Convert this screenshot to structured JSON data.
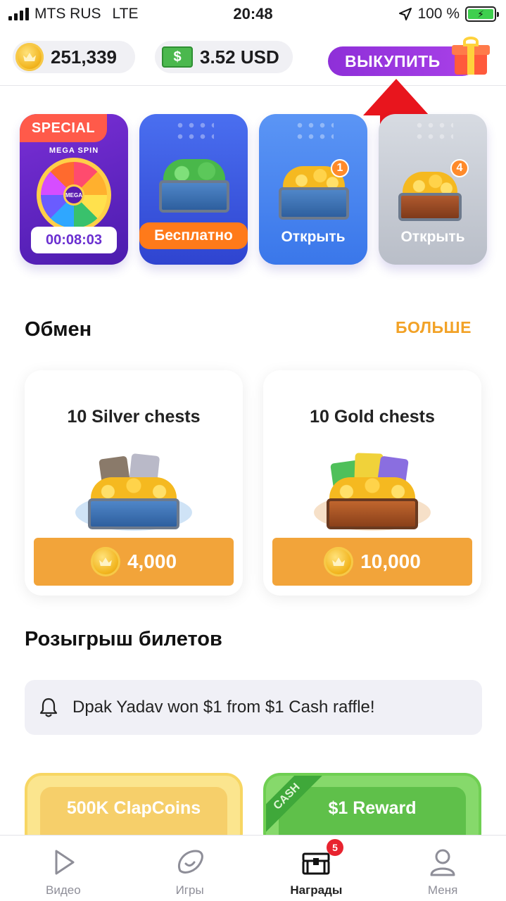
{
  "status_bar": {
    "carrier": "MTS RUS",
    "network": "LTE",
    "time": "20:48",
    "battery": "100 %"
  },
  "header": {
    "coins": "251,339",
    "cash": "3.52 USD",
    "redeem_label": "ВЫКУПИТЬ"
  },
  "chests": {
    "special_tag": "SPECIAL",
    "wheel_top_label": "MEGA SPIN",
    "wheel_hub_label": "MEGA",
    "timer": "00:08:03",
    "free_label": "Бесплатно",
    "open1_label": "Открыть",
    "open1_count": "1",
    "open4_label": "Открыть",
    "open4_count": "4"
  },
  "exchange": {
    "title": "Обмен",
    "more_label": "БОЛЬШЕ",
    "items": [
      {
        "title": "10 Silver chests",
        "price": "4,000"
      },
      {
        "title": "10 Gold chests",
        "price": "10,000"
      }
    ]
  },
  "raffle": {
    "title": "Розыгрыш билетов",
    "notice": "Dpak Yadav won $1 from $1 Cash raffle!",
    "cards": [
      {
        "title": "500K ClapCoins"
      },
      {
        "title": "$1 Reward",
        "ribbon": "CASH"
      }
    ]
  },
  "tabs": {
    "items": [
      {
        "label": "Видео",
        "icon": "play-icon"
      },
      {
        "label": "Игры",
        "icon": "game-icon"
      },
      {
        "label": "Награды",
        "icon": "chest-icon"
      },
      {
        "label": "Меня",
        "icon": "profile-icon"
      }
    ],
    "active": "Награды",
    "rewards_badge": "5"
  },
  "colors": {
    "accent_purple": "#9b39e0",
    "accent_orange": "#f2a43a",
    "badge_red": "#e8232f"
  }
}
